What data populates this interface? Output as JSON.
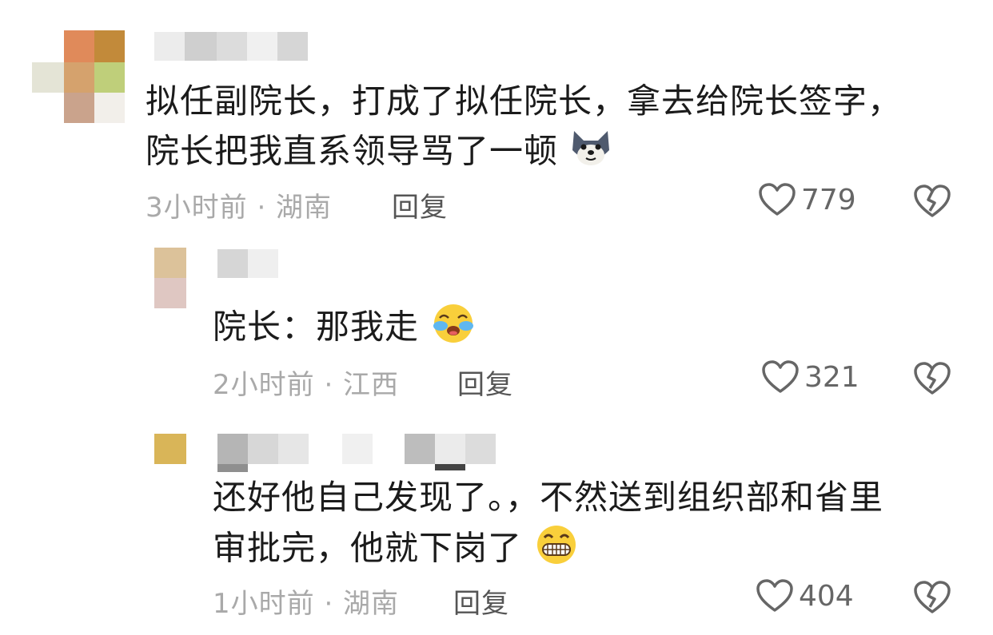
{
  "comments": [
    {
      "text_line1": "拟任副院长，打成了拟任院长，拿去给院长签字，",
      "text_line2": "院长把我直系领导骂了一顿",
      "emoji": "wolf-face-icon",
      "time_location": "3小时前 · 湖南",
      "reply_label": "回复",
      "likes": "779"
    },
    {
      "text_line1": "院长：那我走",
      "emoji": "crying-face-icon",
      "time_location": "2小时前 · 江西",
      "reply_label": "回复",
      "likes": "321"
    },
    {
      "text_line1": "还好他自己发现了。，不然送到组织部和省里",
      "text_line2": "审批完，他就下岗了",
      "emoji": "grinning-face-icon",
      "time_location": "1小时前 · 湖南",
      "reply_label": "回复",
      "likes": "404"
    }
  ],
  "colors": {
    "text": "#1b1b1b",
    "meta": "#a9a9a9",
    "reply": "#555555",
    "icon": "#666666"
  }
}
